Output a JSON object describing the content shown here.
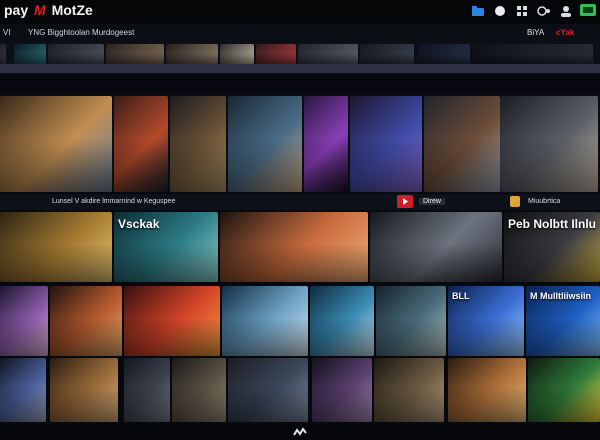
{
  "app": {
    "logo_left": "pay",
    "logo_accent": "M",
    "logo_right": "MotZe"
  },
  "subnav": {
    "left_short": "VI",
    "left_label": "YNG Bigghtoolan Murdogeest",
    "right_a": "BiYA",
    "right_b": "cYak"
  },
  "top_icons": [
    "folder-icon",
    "chat-icon",
    "grid-icon",
    "settings-icon",
    "profile-icon",
    "screen-icon"
  ],
  "row1": {
    "tiles": [
      {
        "name": "tile-r1-0",
        "cap": "",
        "colors": [
          "#1b1f27",
          "#3b3f4a"
        ]
      },
      {
        "name": "tile-r1-1",
        "cap": "",
        "colors": [
          "#0b1a24",
          "#2b6d74"
        ]
      },
      {
        "name": "tile-r1-2",
        "cap": "",
        "colors": [
          "#1a1f26",
          "#4c525c"
        ]
      },
      {
        "name": "tile-r1-3",
        "cap": "",
        "colors": [
          "#2a2420",
          "#7f6a55"
        ]
      },
      {
        "name": "tile-r1-4",
        "cap": "",
        "colors": [
          "#24201c",
          "#8a7d67"
        ]
      },
      {
        "name": "tile-r1-5",
        "cap": "",
        "colors": [
          "#292a2d",
          "#c2b59d"
        ]
      },
      {
        "name": "tile-r1-6",
        "cap": "",
        "colors": [
          "#301b1d",
          "#a63c3d"
        ]
      },
      {
        "name": "tile-r1-7",
        "cap": "",
        "colors": [
          "#20232a",
          "#59606b"
        ]
      },
      {
        "name": "tile-r1-8",
        "cap": "",
        "colors": [
          "#141820",
          "#3b4250"
        ]
      },
      {
        "name": "tile-r1-9",
        "cap": "",
        "colors": [
          "#0e1220",
          "#27314a"
        ]
      },
      {
        "name": "tile-r1-10",
        "cap": "",
        "colors": [
          "#0e1018",
          "#2a2d39"
        ]
      }
    ]
  },
  "row2": {
    "tiles": [
      {
        "name": "tile-r2-0",
        "colors": [
          "#3a2a18",
          "#c18e52",
          "#6a7f9c"
        ]
      },
      {
        "name": "tile-r2-1",
        "colors": [
          "#3c1d16",
          "#b34a2a",
          "#1c2530"
        ]
      },
      {
        "name": "tile-r2-2",
        "colors": [
          "#1c1b1f",
          "#6d5437",
          "#b79a6a"
        ]
      },
      {
        "name": "tile-r2-3",
        "colors": [
          "#1a2835",
          "#4a6b86",
          "#d9b389"
        ]
      },
      {
        "name": "tile-r2-4",
        "colors": [
          "#2b1740",
          "#8a3fb8",
          "#1c1029"
        ]
      },
      {
        "name": "tile-r2-5",
        "colors": [
          "#1d1830",
          "#3f4ba6",
          "#8c6ad0"
        ]
      },
      {
        "name": "tile-r2-6",
        "colors": [
          "#20242c",
          "#6e4e39",
          "#9da7b4"
        ]
      },
      {
        "name": "tile-r2-7",
        "colors": [
          "#1a1d24",
          "#5b5e66",
          "#c3b7a6"
        ]
      }
    ]
  },
  "mid": {
    "label": "Lunsel V akdire lmmarnind w Keguspee",
    "pill": "Direw",
    "right_label": "Miuubrtica"
  },
  "row3": {
    "tiles": [
      {
        "name": "tile-r3-0",
        "colors": [
          "#2b2414",
          "#a47a31",
          "#e6c474"
        ]
      },
      {
        "name": "tile-r3-1",
        "title": "Vsckak",
        "colors": [
          "#0c2a33",
          "#2d7d86",
          "#8ed1cf"
        ]
      },
      {
        "name": "tile-r3-2",
        "colors": [
          "#1b1410",
          "#c96c3d",
          "#f2b07a"
        ]
      },
      {
        "name": "tile-r3-3",
        "colors": [
          "#15171c",
          "#6d7480",
          "#2b2e36"
        ]
      },
      {
        "name": "tile-r3-4",
        "title": "Peb Nolbtt Ilnlu",
        "colors": [
          "#0e0e10",
          "#3a3c42",
          "#d1b045"
        ]
      }
    ]
  },
  "row4": {
    "tiles": [
      {
        "name": "tile-r4-0",
        "colors": [
          "#1d1830",
          "#8b5ba8",
          "#e4b3d8"
        ]
      },
      {
        "name": "tile-r4-1",
        "colors": [
          "#20140f",
          "#b65a2e",
          "#e8b070"
        ]
      },
      {
        "name": "tile-r4-2",
        "colors": [
          "#3a0f0f",
          "#d6452a",
          "#f0a040"
        ]
      },
      {
        "name": "tile-r4-3",
        "colors": [
          "#123045",
          "#6ea3c7",
          "#dce9f2"
        ]
      },
      {
        "name": "tile-r4-4",
        "colors": [
          "#0d2a3b",
          "#3b8bb5",
          "#cfe6f0"
        ]
      },
      {
        "name": "tile-r4-5",
        "colors": [
          "#16222a",
          "#4c6e7e",
          "#b8c7c4"
        ]
      },
      {
        "name": "tile-r4-6",
        "title": "BLL",
        "colors": [
          "#0c1f4a",
          "#3b6fd6",
          "#9fd0ff"
        ]
      },
      {
        "name": "tile-r4-7",
        "title": "M Mulltliiwsiin",
        "colors": [
          "#0a2150",
          "#1d5fc2",
          "#86c4ff"
        ]
      }
    ]
  },
  "row5": {
    "tiles": [
      {
        "name": "tile-r5-0",
        "colors": [
          "#101523",
          "#4b5f9a",
          "#a1a9c6"
        ]
      },
      {
        "name": "tile-r5-1",
        "colors": [
          "#2a1c10",
          "#9b6b3a",
          "#d8b080"
        ]
      },
      {
        "name": "tile-r5-2",
        "colors": [
          "#14171d",
          "#3d434e",
          "#7a808c"
        ]
      },
      {
        "name": "tile-r5-3",
        "colors": [
          "#1b1a17",
          "#5a5244",
          "#9b907a"
        ]
      },
      {
        "name": "tile-r5-4",
        "colors": [
          "#1a1d24",
          "#3a4658",
          "#7d8aa0"
        ]
      },
      {
        "name": "tile-r5-5",
        "colors": [
          "#13111c",
          "#5a3f6e",
          "#a78bb6"
        ]
      },
      {
        "name": "tile-r5-6",
        "colors": [
          "#1c1712",
          "#6a5a42",
          "#bba382"
        ]
      },
      {
        "name": "tile-r5-7",
        "colors": [
          "#2a1a10",
          "#b0703a",
          "#e6c07a"
        ]
      },
      {
        "name": "tile-r5-8",
        "colors": [
          "#0e1a10",
          "#2f7a3a",
          "#f2d43a"
        ]
      }
    ]
  },
  "footer": {
    "icon": "logo-mark-icon"
  }
}
